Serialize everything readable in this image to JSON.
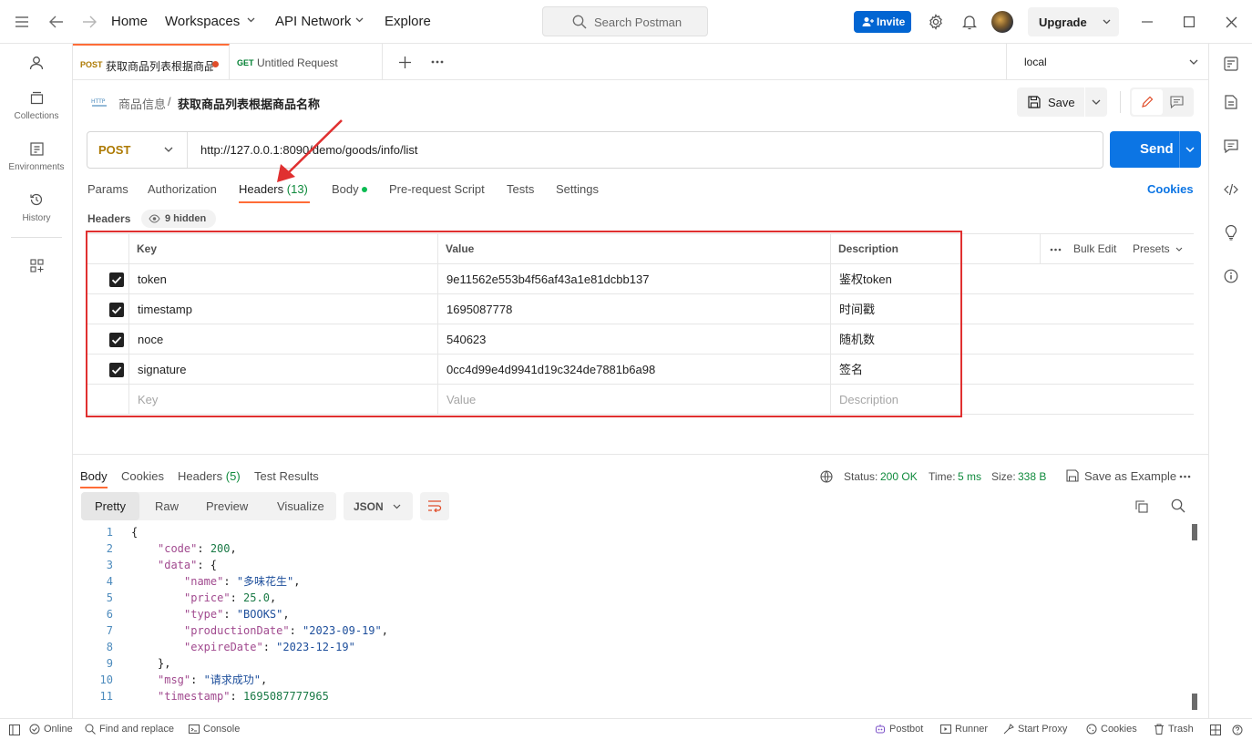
{
  "nav": {
    "home": "Home",
    "workspaces": "Workspaces",
    "api_network": "API Network",
    "explore": "Explore",
    "search_placeholder": "Search Postman",
    "invite": "Invite",
    "upgrade": "Upgrade"
  },
  "sidebar": {
    "items": [
      {
        "label": "",
        "icon": "user-icon"
      },
      {
        "label": "Collections",
        "icon": "collections-icon"
      },
      {
        "label": "Environments",
        "icon": "environments-icon"
      },
      {
        "label": "History",
        "icon": "history-icon"
      },
      {
        "label": "",
        "icon": "grid-plus-icon"
      }
    ]
  },
  "tabs": [
    {
      "method": "POST",
      "title": "获取商品列表根据商品",
      "unsaved": true
    },
    {
      "method": "GET",
      "title": "Untitled Request",
      "unsaved": false
    }
  ],
  "environment": "local",
  "breadcrumb": {
    "collection": "商品信息",
    "separator": "/",
    "request": "获取商品列表根据商品名称"
  },
  "toolbar": {
    "save": "Save"
  },
  "request": {
    "method": "POST",
    "url": "http://127.0.0.1:8090/demo/goods/info/list",
    "send": "Send"
  },
  "request_tabs": {
    "params": "Params",
    "authorization": "Authorization",
    "headers": "Headers",
    "headers_count": "(13)",
    "body": "Body",
    "prerequest": "Pre-request Script",
    "tests": "Tests",
    "settings": "Settings",
    "cookies": "Cookies"
  },
  "headers_section": {
    "title": "Headers",
    "hidden": "9 hidden",
    "bulk_edit": "Bulk Edit",
    "presets": "Presets"
  },
  "headers_table": {
    "columns": [
      "Key",
      "Value",
      "Description"
    ],
    "rows": [
      {
        "key": "token",
        "value": "9e11562e553b4f56af43a1e81dcbb137",
        "description": "鉴权token",
        "checked": true
      },
      {
        "key": "timestamp",
        "value": "1695087778",
        "description": "时间戳",
        "checked": true
      },
      {
        "key": "noce",
        "value": "540623",
        "description": "随机数",
        "checked": true
      },
      {
        "key": "signature",
        "value": "0cc4d99e4d9941d19c324de7881b6a98",
        "description": "签名",
        "checked": true
      }
    ],
    "placeholder": {
      "key": "Key",
      "value": "Value",
      "description": "Description"
    }
  },
  "response": {
    "tabs": {
      "body": "Body",
      "cookies": "Cookies",
      "headers": "Headers",
      "headers_count": "(5)",
      "test_results": "Test Results"
    },
    "status_label": "Status:",
    "status_value": "200 OK",
    "time_label": "Time:",
    "time_value": "5 ms",
    "size_label": "Size:",
    "size_value": "338 B",
    "save_example": "Save as Example",
    "view_modes": [
      "Pretty",
      "Raw",
      "Preview",
      "Visualize"
    ],
    "format": "JSON",
    "line_numbers": [
      "1",
      "2",
      "3",
      "4",
      "5",
      "6",
      "7",
      "8",
      "9",
      "10",
      "11"
    ],
    "json_lines": [
      {
        "indent": 0,
        "parts": [
          {
            "t": "p",
            "v": "{"
          }
        ]
      },
      {
        "indent": 1,
        "parts": [
          {
            "t": "k",
            "v": "\"code\""
          },
          {
            "t": "p",
            "v": ": "
          },
          {
            "t": "n",
            "v": "200"
          },
          {
            "t": "p",
            "v": ","
          }
        ]
      },
      {
        "indent": 1,
        "parts": [
          {
            "t": "k",
            "v": "\"data\""
          },
          {
            "t": "p",
            "v": ": {"
          }
        ]
      },
      {
        "indent": 2,
        "parts": [
          {
            "t": "k",
            "v": "\"name\""
          },
          {
            "t": "p",
            "v": ": "
          },
          {
            "t": "s",
            "v": "\"多味花生\""
          },
          {
            "t": "p",
            "v": ","
          }
        ]
      },
      {
        "indent": 2,
        "parts": [
          {
            "t": "k",
            "v": "\"price\""
          },
          {
            "t": "p",
            "v": ": "
          },
          {
            "t": "n",
            "v": "25.0"
          },
          {
            "t": "p",
            "v": ","
          }
        ]
      },
      {
        "indent": 2,
        "parts": [
          {
            "t": "k",
            "v": "\"type\""
          },
          {
            "t": "p",
            "v": ": "
          },
          {
            "t": "s",
            "v": "\"BOOKS\""
          },
          {
            "t": "p",
            "v": ","
          }
        ]
      },
      {
        "indent": 2,
        "parts": [
          {
            "t": "k",
            "v": "\"productionDate\""
          },
          {
            "t": "p",
            "v": ": "
          },
          {
            "t": "s",
            "v": "\"2023-09-19\""
          },
          {
            "t": "p",
            "v": ","
          }
        ]
      },
      {
        "indent": 2,
        "parts": [
          {
            "t": "k",
            "v": "\"expireDate\""
          },
          {
            "t": "p",
            "v": ": "
          },
          {
            "t": "s",
            "v": "\"2023-12-19\""
          }
        ]
      },
      {
        "indent": 1,
        "parts": [
          {
            "t": "p",
            "v": "},"
          }
        ]
      },
      {
        "indent": 1,
        "parts": [
          {
            "t": "k",
            "v": "\"msg\""
          },
          {
            "t": "p",
            "v": ": "
          },
          {
            "t": "s",
            "v": "\"请求成功\""
          },
          {
            "t": "p",
            "v": ","
          }
        ]
      },
      {
        "indent": 1,
        "parts": [
          {
            "t": "k",
            "v": "\"timestamp\""
          },
          {
            "t": "p",
            "v": ": "
          },
          {
            "t": "n",
            "v": "1695087777965"
          }
        ]
      }
    ]
  },
  "statusbar": {
    "online": "Online",
    "find_replace": "Find and replace",
    "console": "Console",
    "postbot": "Postbot",
    "runner": "Runner",
    "start_proxy": "Start Proxy",
    "cookies": "Cookies",
    "trash": "Trash"
  },
  "colors": {
    "accent": "#0c75e4",
    "post_method": "#ad7a03",
    "get_method": "#007f31",
    "status_ok": "#0f8a3c",
    "highlight_box": "#e03030",
    "tab_underline": "#ff6c37"
  }
}
